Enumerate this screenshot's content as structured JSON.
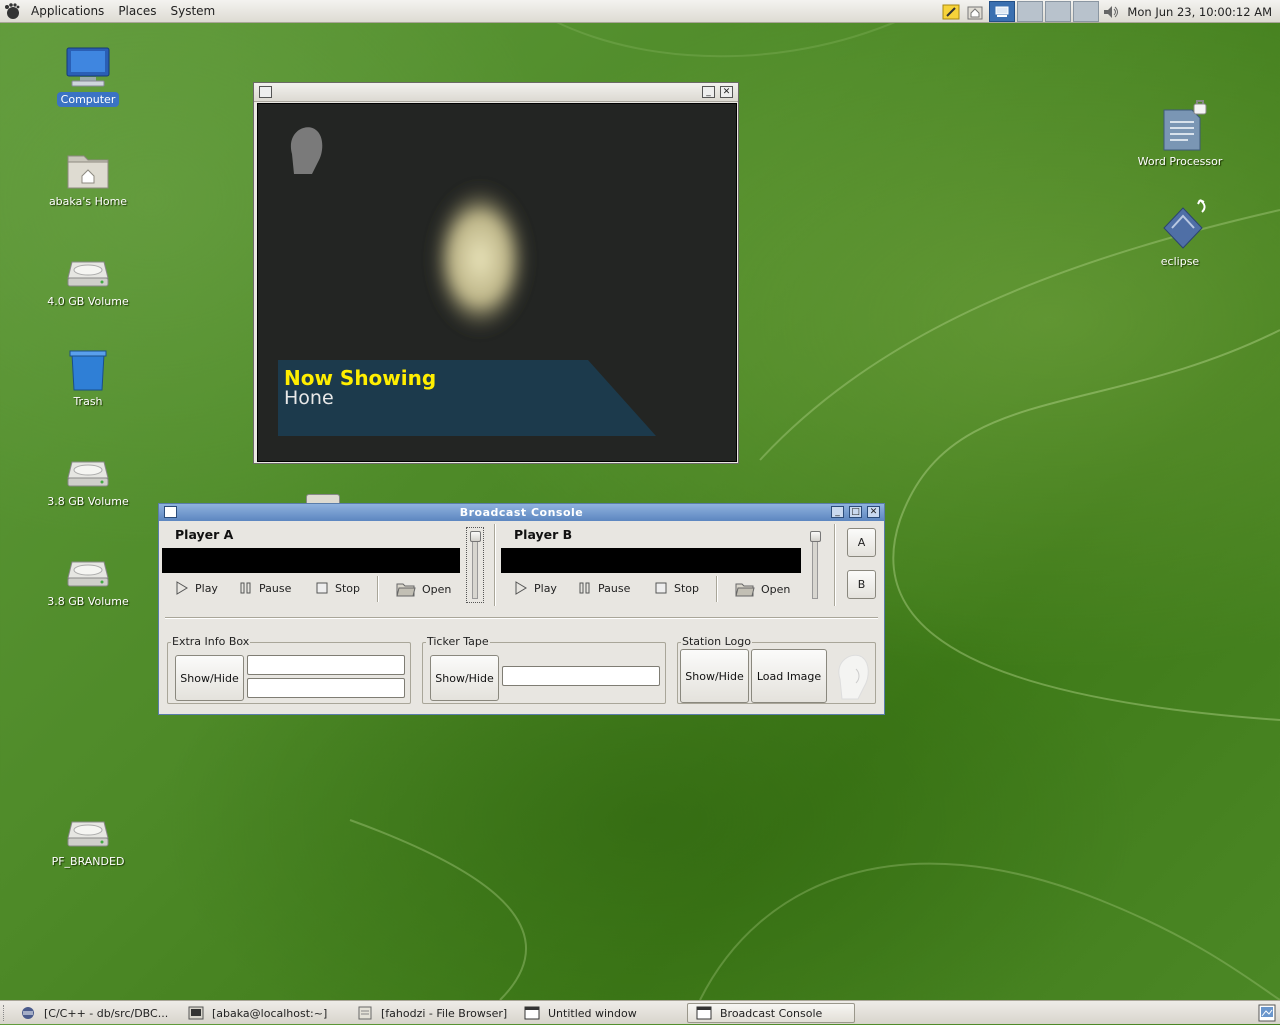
{
  "top_panel": {
    "menus": [
      "Applications",
      "Places",
      "System"
    ],
    "clock": "Mon Jun 23, 10:00:12 AM"
  },
  "desktop_icons": [
    {
      "label": "Computer",
      "icon": "computer-icon"
    },
    {
      "label": "abaka's Home",
      "icon": "home-folder-icon"
    },
    {
      "label": "4.0 GB Volume",
      "icon": "drive-icon"
    },
    {
      "label": "Trash",
      "icon": "trash-icon"
    },
    {
      "label": "3.8 GB Volume",
      "icon": "drive-icon"
    },
    {
      "label": "3.8 GB Volume",
      "icon": "drive-icon"
    },
    {
      "label": "PF_BRANDED",
      "icon": "drive-icon"
    },
    {
      "label": "Word Processor",
      "icon": "word-processor-icon"
    },
    {
      "label": "eclipse",
      "icon": "eclipse-icon"
    }
  ],
  "video_window": {
    "lower_third_title": "Now Showing",
    "lower_third_subtitle": "Hone"
  },
  "console": {
    "title": "Broadcast Console",
    "player_a": {
      "label": "Player A",
      "play": "Play",
      "pause": "Pause",
      "stop": "Stop",
      "open": "Open"
    },
    "player_b": {
      "label": "Player B",
      "play": "Play",
      "pause": "Pause",
      "stop": "Stop",
      "open": "Open"
    },
    "switch_a": "A",
    "switch_b": "B",
    "extra_info": {
      "title": "Extra Info Box",
      "show_hide": "Show/Hide",
      "line1": "",
      "line2": ""
    },
    "ticker": {
      "title": "Ticker Tape",
      "show_hide": "Show/Hide",
      "text": ""
    },
    "station_logo": {
      "title": "Station Logo",
      "show_hide": "Show/Hide",
      "load_image": "Load Image"
    }
  },
  "taskbar": [
    {
      "label": "[C/C++ - db/src/DBC...",
      "active": false
    },
    {
      "label": "[abaka@localhost:~]",
      "active": false
    },
    {
      "label": "[fahodzi - File Browser]",
      "active": false
    },
    {
      "label": "Untitled window",
      "active": false
    },
    {
      "label": "Broadcast Console",
      "active": true
    }
  ],
  "colors": {
    "desktop": "#4e8a28",
    "lower_third_title": "#ffee00",
    "console_titlebar": "#5c86c0"
  }
}
